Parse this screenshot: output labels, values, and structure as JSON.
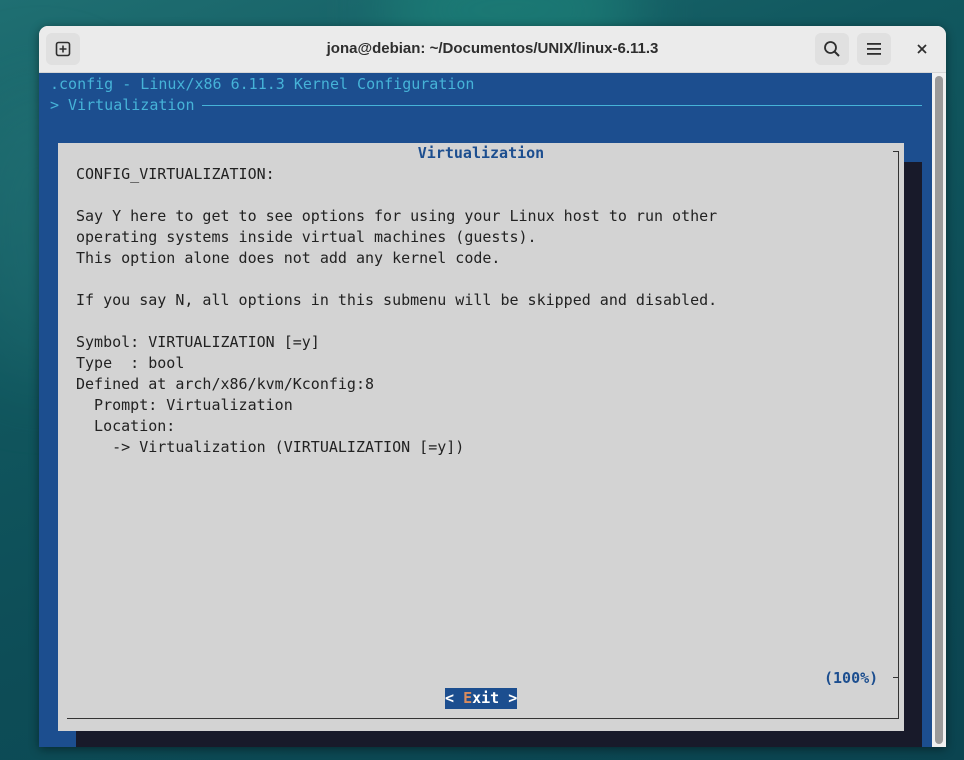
{
  "window": {
    "title": "jona@debian: ~/Documentos/UNIX/linux-6.11.3",
    "new_tab_icon": "new-tab-icon",
    "search_icon": "search-icon",
    "menu_icon": "hamburger-menu-icon",
    "close_icon": "close-icon"
  },
  "terminal": {
    "header_line1": ".config - Linux/x86 6.11.3 Kernel Configuration",
    "header_line2": "> Virtualization",
    "colors": {
      "background": "#1c4e8f",
      "header_text": "#46b3d8",
      "dialog_bg": "#d3d3d3",
      "accent": "#1c4e8f"
    }
  },
  "dialog": {
    "title": "Virtualization",
    "lines": [
      "CONFIG_VIRTUALIZATION:",
      "",
      "Say Y here to get to see options for using your Linux host to run other",
      "operating systems inside virtual machines (guests).",
      "This option alone does not add any kernel code.",
      "",
      "If you say N, all options in this submenu will be skipped and disabled.",
      "",
      "Symbol: VIRTUALIZATION [=y]",
      "Type  : bool",
      "Defined at arch/x86/kvm/Kconfig:8",
      "  Prompt: Virtualization",
      "  Location:",
      "    -> Virtualization (VIRTUALIZATION [=y])"
    ],
    "scroll_percent": "(100%)",
    "exit_button": {
      "prefix": "< ",
      "hotkey": "E",
      "rest": "xit >"
    }
  }
}
